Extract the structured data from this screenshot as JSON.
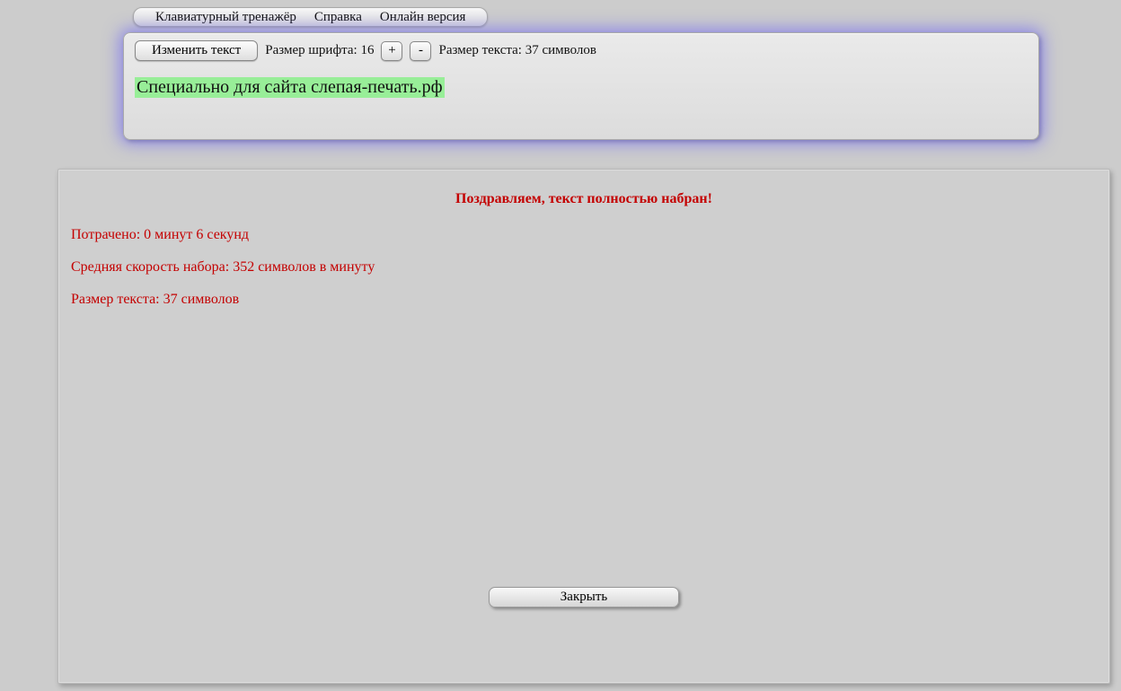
{
  "menu": {
    "items": [
      "Клавиатурный тренажёр",
      "Справка",
      "Онлайн версия"
    ]
  },
  "toolbar": {
    "change_text_label": "Изменить текст",
    "font_size_label": "Размер шрифта: ",
    "font_size_value": "16",
    "plus_label": "+",
    "minus_label": "-",
    "text_size_label": "Размер текста: 37 символов"
  },
  "typing": {
    "completed_text": "Специально для сайта слепая-печать.рф"
  },
  "result": {
    "congrats": "Поздравляем, текст полностью набран!",
    "time_spent": "Потрачено: 0 минут 6 секунд",
    "avg_speed": "Средняя скорость набора: 352 символов в минуту",
    "text_size": "Размер текста: 37 символов",
    "close_label": "Закрыть"
  }
}
